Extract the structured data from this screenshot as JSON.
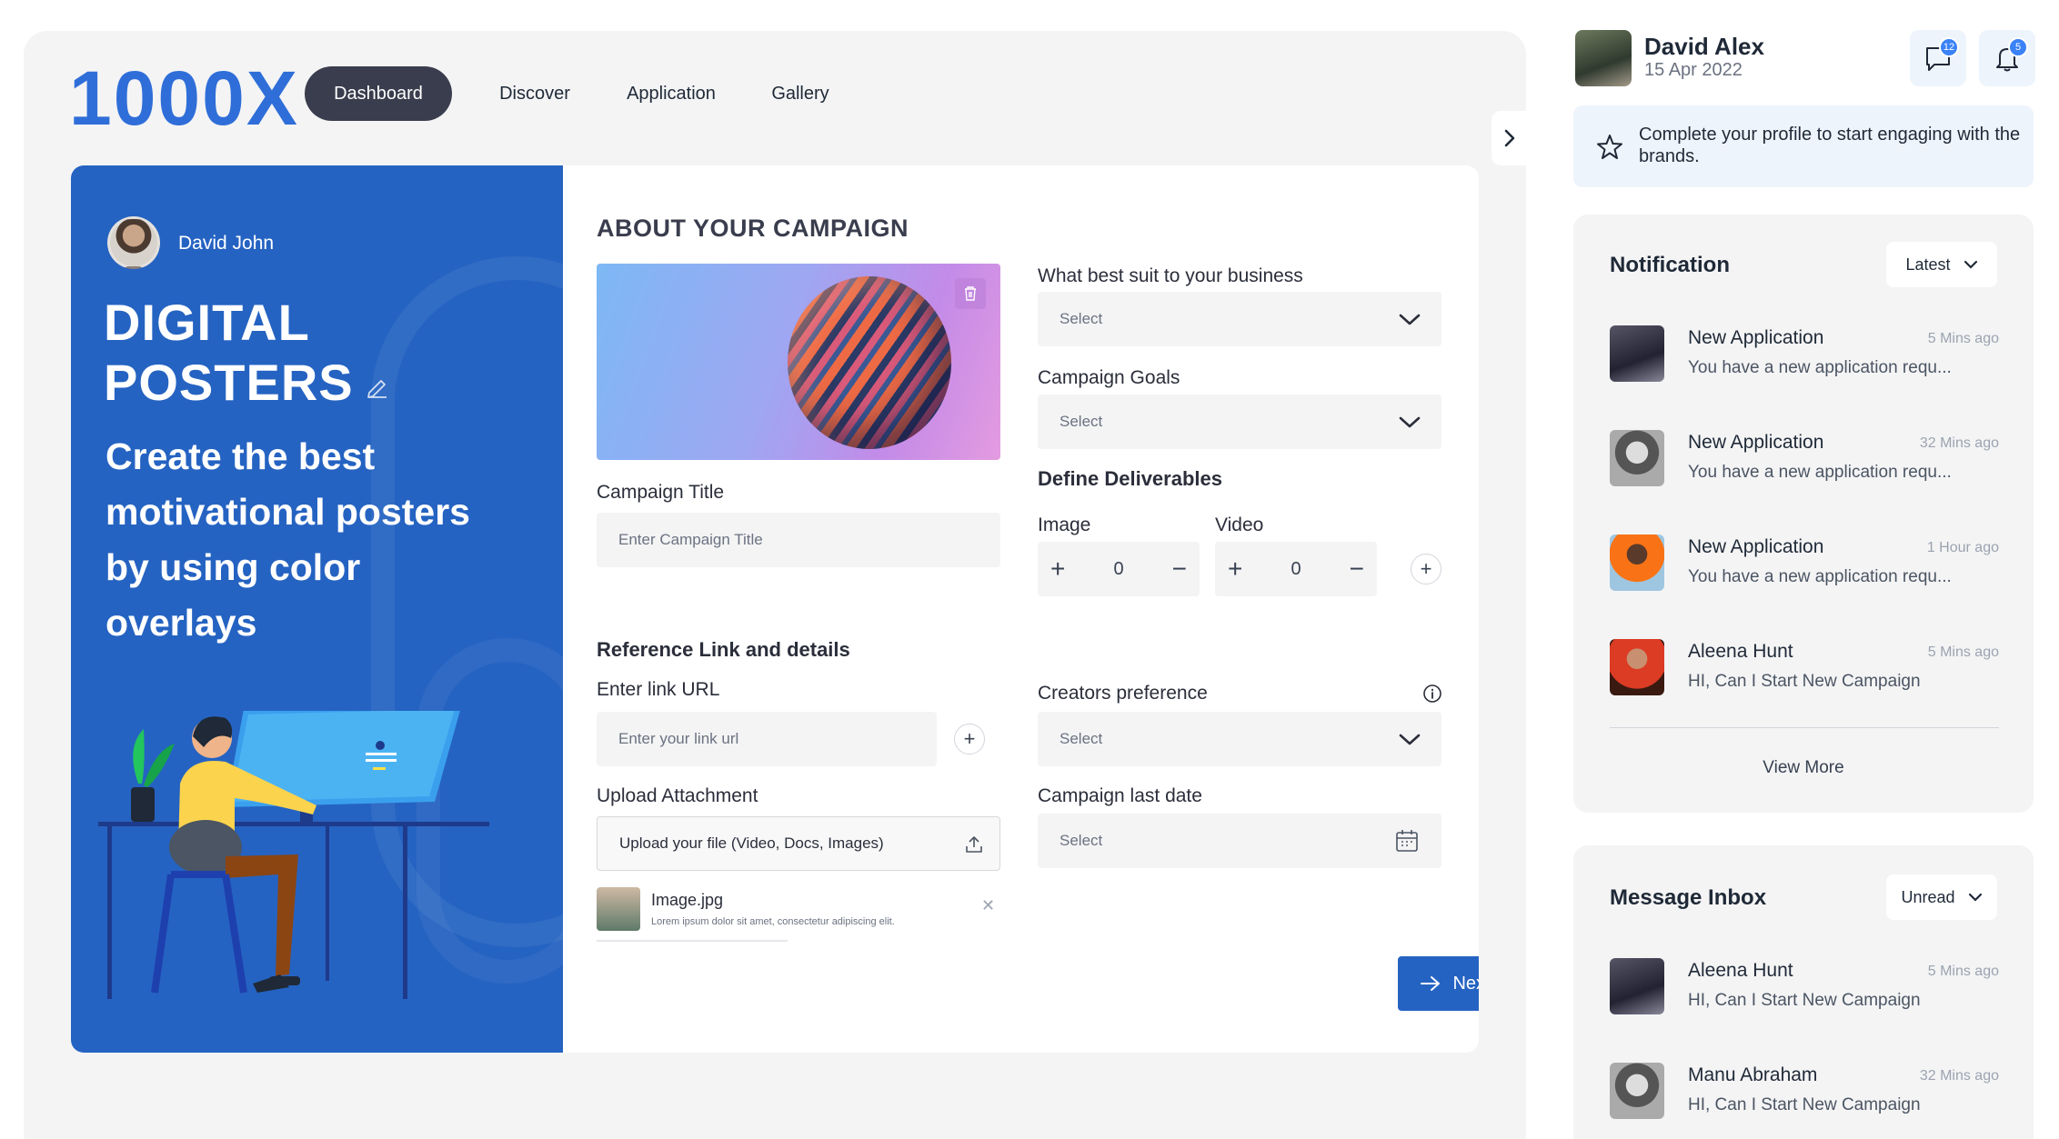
{
  "brand": {
    "logo": "1000X"
  },
  "nav": {
    "items": [
      {
        "label": "Dashboard",
        "active": true
      },
      {
        "label": "Discover",
        "active": false
      },
      {
        "label": "Application",
        "active": false
      },
      {
        "label": "Gallery",
        "active": false
      }
    ]
  },
  "hero": {
    "user_name": "David John",
    "title_line1": "DIGITAL",
    "title_line2": "POSTERS",
    "subtitle": "Create the best motivational posters by using color overlays",
    "accent": "#2563c2"
  },
  "form": {
    "section_title": "ABOUT YOUR CAMPAIGN",
    "campaign_title_label": "Campaign Title",
    "campaign_title_placeholder": "Enter Campaign Title",
    "business_label": "What best suit to your business",
    "business_value": "Select",
    "goals_label": "Campaign Goals",
    "goals_value": "Select",
    "deliverables_title": "Define Deliverables",
    "image_label": "Image",
    "image_count": "0",
    "video_label": "Video",
    "video_count": "0",
    "reference_title": "Reference Link and details",
    "link_label": "Enter link URL",
    "link_placeholder": "Enter your link url",
    "creators_label": "Creators preference",
    "creators_value": "Select",
    "upload_label": "Upload Attachment",
    "upload_placeholder": "Upload your file (Video, Docs, Images)",
    "last_date_label": "Campaign last date",
    "last_date_value": "Select",
    "attachment_name": "Image.jpg",
    "attachment_desc": "Lorem ipsum dolor sit amet, consectetur adipiscing elit.",
    "next_label": "Next"
  },
  "profile": {
    "name": "David Alex",
    "date": "15 Apr 2022",
    "message_badge": "12",
    "notification_badge": "5"
  },
  "banner": {
    "text": "Complete your profile to start engaging with the brands."
  },
  "notifications": {
    "title": "Notification",
    "filter": "Latest",
    "items": [
      {
        "title": "New Application",
        "time": "5 Mins ago",
        "body": "You have a new application requ..."
      },
      {
        "title": "New Application",
        "time": "32 Mins ago",
        "body": "You have a new application requ..."
      },
      {
        "title": "New Application",
        "time": "1 Hour ago",
        "body": "You have a new application requ..."
      },
      {
        "title": "Aleena Hunt",
        "time": "5 Mins ago",
        "body": "HI, Can I Start New Campaign"
      }
    ],
    "view_more": "View More"
  },
  "inbox": {
    "title": "Message Inbox",
    "filter": "Unread",
    "items": [
      {
        "title": "Aleena Hunt",
        "time": "5 Mins ago",
        "body": "HI, Can I Start New Campaign"
      },
      {
        "title": "Manu Abraham",
        "time": "32 Mins ago",
        "body": "HI, Can I Start New Campaign"
      }
    ]
  }
}
